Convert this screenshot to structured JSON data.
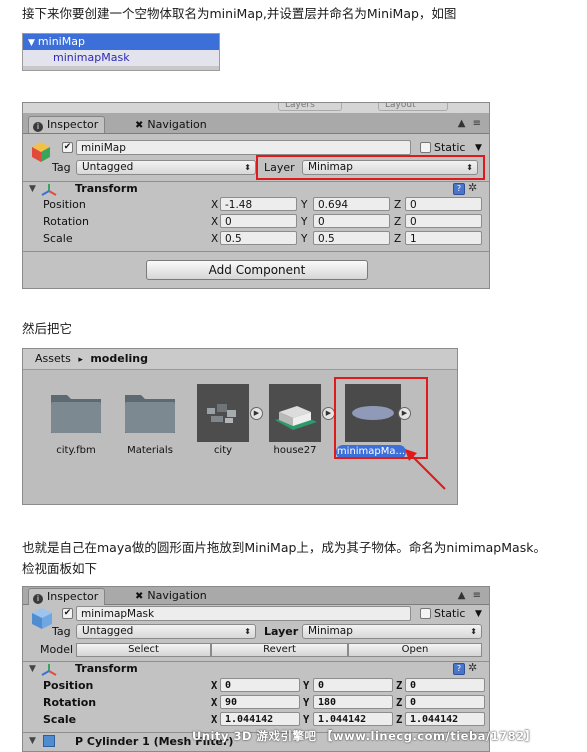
{
  "paragraphs": {
    "p1": "接下来你要创建一个空物体取名为miniMap,并设置层并命名为MiniMap，如图",
    "p2": "然后把它",
    "p3_line1": "也就是自己在maya做的圆形面片拖放到MiniMap上，成为其子物体。命名为nimimapMask。",
    "p3_line2": "检视面板如下"
  },
  "hierarchy": {
    "row1": "miniMap",
    "row2": "minimapMask"
  },
  "inspector1": {
    "tabs": [
      "Inspector",
      "Navigation"
    ],
    "object_name": "miniMap",
    "static_label": "Static",
    "tag_label": "Tag",
    "tag_value": "Untagged",
    "layer_label": "Layer",
    "layer_value": "Minimap",
    "top_faint": [
      "Layers",
      "Layout"
    ],
    "transform_title": "Transform",
    "rows": [
      {
        "label": "Position",
        "x": "-1.48",
        "y": "0.694",
        "z": "0"
      },
      {
        "label": "Rotation",
        "x": "0",
        "y": "0",
        "z": "0"
      },
      {
        "label": "Scale",
        "x": "0.5",
        "y": "0.5",
        "z": "1"
      }
    ],
    "add_component": "Add Component",
    "axis": {
      "x": "X",
      "y": "Y",
      "z": "Z"
    }
  },
  "project": {
    "breadcrumb_root": "Assets",
    "breadcrumb_sep": "▸",
    "breadcrumb_folder": "modeling",
    "assets": [
      "city.fbm",
      "Materials",
      "city",
      "house27",
      "minimapMa..."
    ]
  },
  "inspector2": {
    "tabs": [
      "Inspector",
      "Navigation"
    ],
    "object_name": "minimapMask",
    "static_label": "Static",
    "tag_label": "Tag",
    "tag_value": "Untagged",
    "layer_label": "Layer",
    "layer_value": "Minimap",
    "model_label": "Model",
    "model_buttons": [
      "Select",
      "Revert",
      "Open"
    ],
    "transform_title": "Transform",
    "rows": [
      {
        "label": "Position",
        "x": "0",
        "y": "0",
        "z": "0"
      },
      {
        "label": "Rotation",
        "x": "90",
        "y": "180",
        "z": "0"
      },
      {
        "label": "Scale",
        "x": "1.044142",
        "y": "1.044142",
        "z": "1.044142"
      }
    ],
    "mesh_filter_title": "P Cylinder 1 (Mesh Filter)",
    "axis": {
      "x": "X",
      "y": "Y",
      "z": "Z"
    }
  },
  "watermark": "Unity 3D 游戏引擎吧 【www.linecg.com/tieba/1782】",
  "colors": {
    "highlight_red": "#e0191b",
    "selection_blue": "#3d6fd8",
    "panel_gray": "#c2c2c2"
  }
}
